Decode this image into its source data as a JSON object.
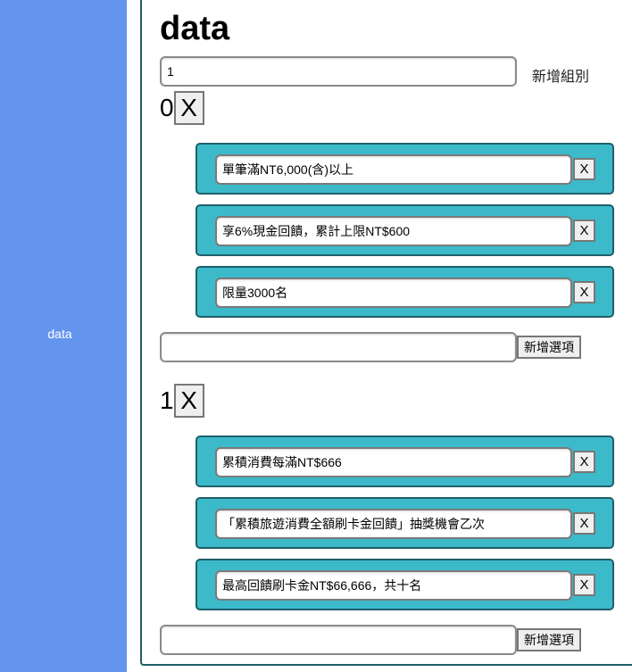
{
  "sidebar": {
    "label": "data"
  },
  "page": {
    "title": "data"
  },
  "group_input": {
    "value": "1",
    "add_label": "新增組別"
  },
  "groups": [
    {
      "index": "0",
      "remove_label": "X",
      "options": [
        {
          "text": "單筆滿NT6,000(含)以上",
          "remove_label": "X"
        },
        {
          "text": "享6%現金回饋，累計上限NT$600",
          "remove_label": "X"
        },
        {
          "text": "限量3000名",
          "remove_label": "X"
        }
      ],
      "new_option_value": "",
      "add_option_label": "新增選項"
    },
    {
      "index": "1",
      "remove_label": "X",
      "options": [
        {
          "text": "累積消費每滿NT$666",
          "remove_label": "X"
        },
        {
          "text": "「累積旅遊消費全額刷卡金回饋」抽獎機會乙次",
          "remove_label": "X"
        },
        {
          "text": "最高回饋刷卡金NT$66,666，共十名",
          "remove_label": "X"
        }
      ],
      "new_option_value": "",
      "add_option_label": "新增選項"
    }
  ]
}
